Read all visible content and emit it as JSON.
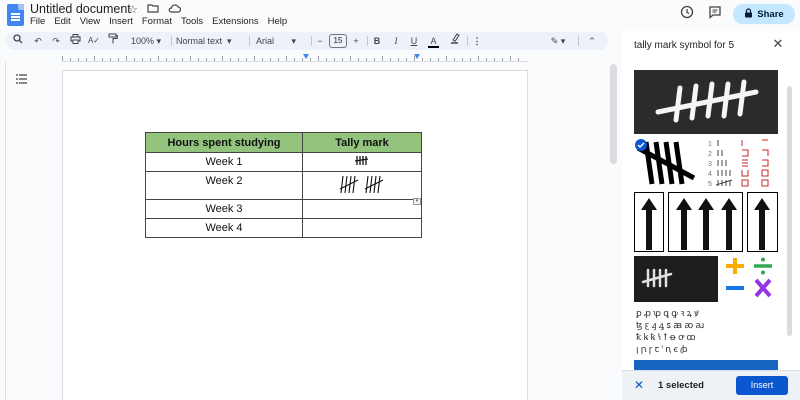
{
  "doc": {
    "title": "Untitled document",
    "menu": [
      "File",
      "Edit",
      "View",
      "Insert",
      "Format",
      "Tools",
      "Extensions",
      "Help"
    ],
    "share_label": "Share"
  },
  "toolbar": {
    "zoom": "100%",
    "style": "Normal text",
    "font": "Arial",
    "font_size": "15",
    "bold": "B",
    "italic": "I",
    "underline": "U",
    "text_color": "A"
  },
  "table": {
    "headers": [
      "Hours spent studying",
      "Tally mark"
    ],
    "rows": [
      {
        "week": "Week 1",
        "tally": 4
      },
      {
        "week": "Week 2",
        "tally": 8
      },
      {
        "week": "Week 3",
        "tally": 0
      },
      {
        "week": "Week 4",
        "tally": 0
      }
    ],
    "header_color": "#93c47d"
  },
  "panel": {
    "search_query": "tally mark symbol for 5",
    "selected_label": "1 selected",
    "insert_label": "Insert",
    "accent": "#0b57d0"
  },
  "icons": {
    "star": "star-icon",
    "folder": "folder-icon",
    "cloud": "cloud-status-icon",
    "history": "history-icon",
    "comment": "comment-icon",
    "lock": "lock-icon"
  }
}
